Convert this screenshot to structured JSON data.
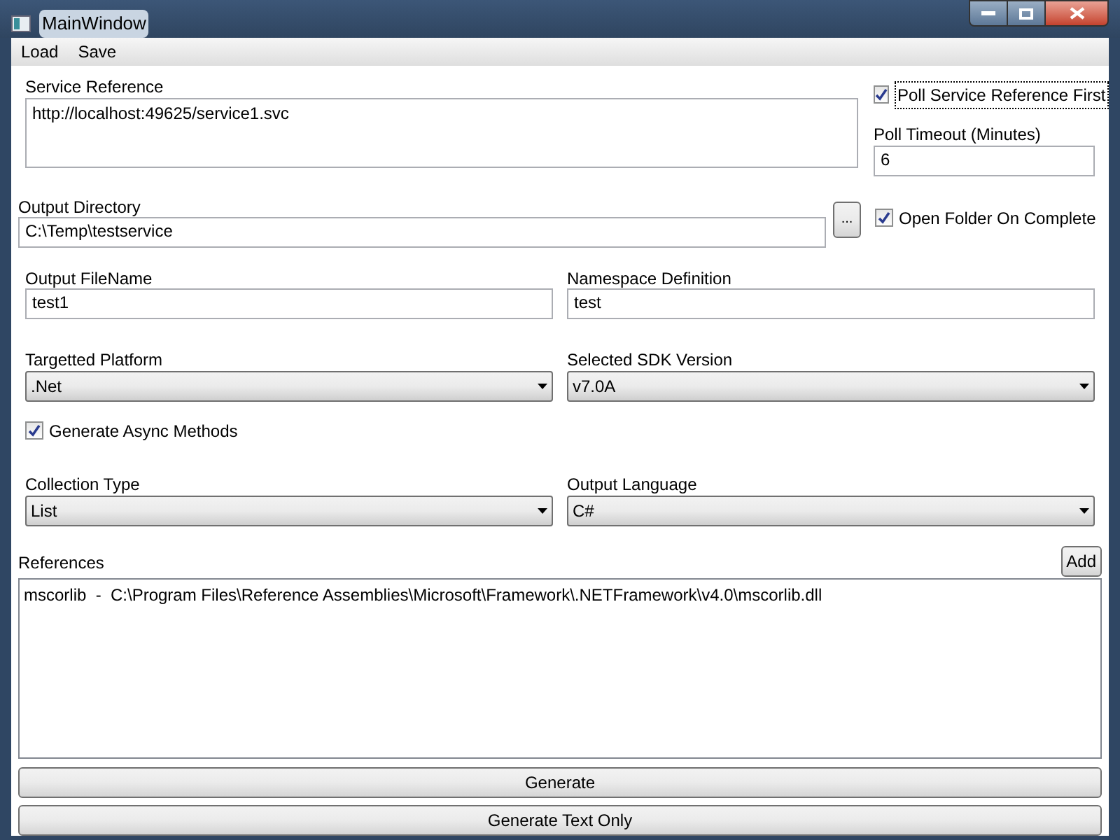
{
  "window": {
    "title": "MainWindow"
  },
  "menu": [
    "Load",
    "Save"
  ],
  "service_reference": {
    "label": "Service Reference",
    "value": "http://localhost:49625/service1.svc"
  },
  "poll_first": {
    "label": "Poll Service Reference First",
    "checked": true
  },
  "poll_timeout": {
    "label": "Poll Timeout (Minutes)",
    "value": "6"
  },
  "output_directory": {
    "label": "Output Directory",
    "value": "C:\\Temp\\testservice"
  },
  "browse_button": "...",
  "open_folder": {
    "label": "Open Folder On Complete",
    "checked": true
  },
  "output_filename": {
    "label": "Output FileName",
    "value": "test1"
  },
  "namespace": {
    "label": "Namespace Definition",
    "value": "test"
  },
  "targeted_platform": {
    "label": "Targetted Platform",
    "value": ".Net"
  },
  "sdk_version": {
    "label": "Selected SDK Version",
    "value": "v7.0A"
  },
  "async_methods": {
    "label": "Generate Async Methods",
    "checked": true
  },
  "collection_type": {
    "label": "Collection Type",
    "value": "List"
  },
  "output_language": {
    "label": "Output Language",
    "value": "C#"
  },
  "references": {
    "label": "References",
    "add_button": "Add",
    "items": [
      "mscorlib  -  C:\\Program Files\\Reference Assemblies\\Microsoft\\Framework\\.NETFramework\\v4.0\\mscorlib.dll"
    ]
  },
  "buttons": [
    "Generate",
    "Generate Text Only"
  ]
}
